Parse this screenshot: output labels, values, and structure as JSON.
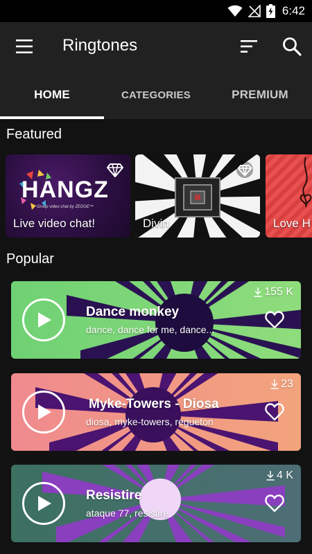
{
  "status_bar": {
    "time": "6:42"
  },
  "app_bar": {
    "title": "Ringtones"
  },
  "tabs": [
    {
      "label": "HOME",
      "active": true
    },
    {
      "label": "CATEGORIES",
      "active": false
    },
    {
      "label": "PREMIUM",
      "active": false
    }
  ],
  "featured": {
    "heading": "Featured",
    "items": [
      {
        "label": "Live video chat!",
        "logo_text": "HANGZ",
        "logo_subtext": "Group video chat by ZEDGE™",
        "premium": true
      },
      {
        "label": "Divin",
        "premium": true
      },
      {
        "label": "Love H"
      }
    ]
  },
  "popular": {
    "heading": "Popular",
    "items": [
      {
        "title": "Dance monkey",
        "tags": "dance, dance for me, dance...",
        "downloads": "155 K",
        "colors": [
          "#6fd174",
          "#8fdc7c"
        ]
      },
      {
        "title": "Myke-Towers - Diosa",
        "tags": "diosa, myke-towers, regueton",
        "downloads": "23",
        "colors": [
          "#f08a8e",
          "#f2a47c"
        ]
      },
      {
        "title": "Resistire",
        "tags": "ataque 77, resistire",
        "downloads": "4 K",
        "colors": [
          "#3c7060",
          "#4d6e75"
        ]
      }
    ]
  },
  "icons": {
    "menu": "menu-icon",
    "sort": "sort-icon",
    "search": "search-icon",
    "premium": "diamond-icon",
    "play": "play-icon",
    "favorite": "heart-outline-icon",
    "download": "download-icon",
    "wifi": "wifi-icon",
    "signal": "signal-icon",
    "battery": "battery-icon"
  },
  "colors": {
    "background": "#121212",
    "app_bar": "#212121",
    "status_bar": "#000000",
    "tab_indicator": "#ffffff"
  }
}
